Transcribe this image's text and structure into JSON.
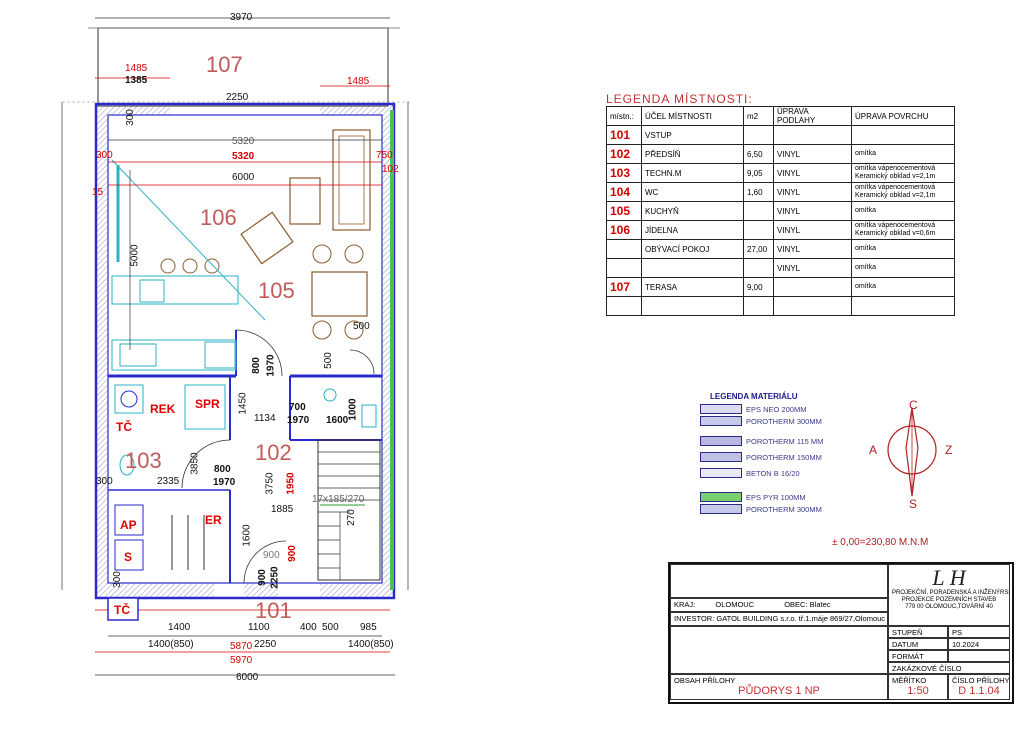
{
  "plan": {
    "rooms": [
      {
        "id": "room-107",
        "label": "107"
      },
      {
        "id": "room-106",
        "label": "106"
      },
      {
        "id": "room-105",
        "label": "105"
      },
      {
        "id": "room-103",
        "label": "103"
      },
      {
        "id": "room-102",
        "label": "102"
      },
      {
        "id": "room-101",
        "label": "101"
      }
    ],
    "tech_labels": {
      "rek": "REK",
      "spr": "SPR",
      "tc_top": "TČ",
      "ap": "AP",
      "er": "ER",
      "s": "S",
      "tc_bottom": "TČ"
    },
    "dims_top": {
      "overall": "3970",
      "left_red": "1485",
      "left_black": "1385",
      "right_red": "1485",
      "terrace": "2250"
    },
    "dims_interior": {
      "d5320": "5320",
      "d5320_red": "5320",
      "d6000": "6000",
      "d5000": "5000",
      "d500a": "500",
      "d500b": "500",
      "d800a": "800",
      "d1970a": "1970",
      "d1134": "1134",
      "d1450": "1450",
      "d700": "700",
      "d1970b": "1970",
      "d1600a": "1600",
      "d1000": "1000",
      "d800b": "800",
      "d1970c": "1970",
      "d2335": "2335",
      "d3850": "3850",
      "d3750": "3750",
      "d1950": "1950",
      "stair": "17x185/270",
      "d1885": "1885",
      "d270": "270",
      "d1600b": "1600",
      "d900a": "900",
      "d900b": "900",
      "d2250": "2250",
      "d300a": "300",
      "d300b": "300",
      "d300c": "300",
      "d300d": "300",
      "d750": "750",
      "d102": "102",
      "d15": "15"
    },
    "dims_bottom": {
      "d1400": "1400",
      "d1100": "1100",
      "d400": "400",
      "d500": "500",
      "d985": "985",
      "d1400_850a": "1400(850)",
      "d2250": "2250",
      "d1400_850b": "1400(850)",
      "d5870": "5870",
      "d5970": "5970",
      "d6000": "6000"
    }
  },
  "room_legend": {
    "title": "LEGENDA   MÍSTNOSTI:",
    "headers": [
      "místn.:",
      "ÚČEL  MÍSTNOSTI",
      "m2",
      "ÚPRAVA PODLAHY",
      "ÚPRAVA POVRCHU"
    ],
    "rows": [
      {
        "num": "101",
        "name": "VSTUP",
        "area": "",
        "floor": "",
        "surface": ""
      },
      {
        "num": "102",
        "name": "PŘEDSÍŇ",
        "area": "6,50",
        "floor": "VINYL",
        "surface": "omítka"
      },
      {
        "num": "103",
        "name": "TECHN.M",
        "area": "9,05",
        "floor": "VINYL",
        "surface": "omítka vápenocementová\nKeramický obklad v=2,1m"
      },
      {
        "num": "104",
        "name": "WC",
        "area": "1,60",
        "floor": "VINYL",
        "surface": "omítka vápenocementová\nKeramický obklad v=2,1m"
      },
      {
        "num": "105",
        "name": "KUCHYŇ",
        "area": "",
        "floor": "VINYL",
        "surface": "omítka"
      },
      {
        "num": "106",
        "name": "JÍDELNA",
        "area": "",
        "floor": "VINYL",
        "surface": "omítka vápenocementová\nKeramický obklad v=0,6m"
      },
      {
        "num": "",
        "name": "OBÝVACÍ POKOJ",
        "area": "27,00",
        "floor": "VINYL",
        "surface": "omítka"
      },
      {
        "num": "",
        "name": "",
        "area": "",
        "floor": "VINYL",
        "surface": "omítka"
      },
      {
        "num": "107",
        "name": "TERASA",
        "area": "9,00",
        "floor": "",
        "surface": "omítka"
      },
      {
        "num": "",
        "name": "",
        "area": "",
        "floor": "",
        "surface": ""
      }
    ]
  },
  "material_legend": {
    "title": "LEGENDA MATERIÁLU",
    "items": [
      {
        "label": "EPS NEO 200MM",
        "color": "#dcdcf0"
      },
      {
        "label": "POROTHERM    300MM",
        "color": "#c8c8e8"
      },
      {
        "label": "POROTHERM 115 MM",
        "color": "#b8b8e0"
      },
      {
        "label": "POROTHERM    150MM",
        "color": "#c0c0e4"
      },
      {
        "label": "BETON B 16/20",
        "color": "#e8e8f6"
      },
      {
        "label": "EPS PYR 100MM",
        "color": "#7ccf6e"
      },
      {
        "label": "POROTHERM    300MM",
        "color": "#c8c8e8"
      }
    ]
  },
  "compass": {
    "north": "C",
    "west": "A",
    "east": "Z",
    "south": "S"
  },
  "elevation": "± 0,00=230,80 M.N.M",
  "title_block": {
    "kraj_label": "KRAJ:",
    "kraj_value": "OLOMOUC",
    "obec_label": "OBEC:",
    "obec_value": "Blatec",
    "investor": "INVESTOR: GATOL BUILDING s.r.o. tř.1.máje 869/27,Olomouc",
    "company_line1": "PROJEKČNÍ, PORADENSKÁ A INŽENÝRSKÁ ČINNOST",
    "company_line2": "PROJEKCE POZEMNÍCH STAVEB",
    "company_line3": "779 00 OLOMOUC,TOVÁRNÍ 40",
    "stupen_label": "STUPEŇ",
    "stupen_value": "PS",
    "datum_label": "DATUM",
    "datum_value": "10.2024",
    "format_label": "FORMÁT",
    "format_value": "",
    "zakazka_label": "ZAKÁZKOVÉ ČÍSLO",
    "zakazka_value": "",
    "obsah_label": "OBSAH PŘÍLOHY",
    "obsah_value": "PŮDORYS 1 NP",
    "meritko_label": "MĚŘÍTKO",
    "meritko_value": "1:50",
    "priloha_label": "ČÍSLO PŘÍLOHY",
    "priloha_value": "D 1.1.04"
  }
}
